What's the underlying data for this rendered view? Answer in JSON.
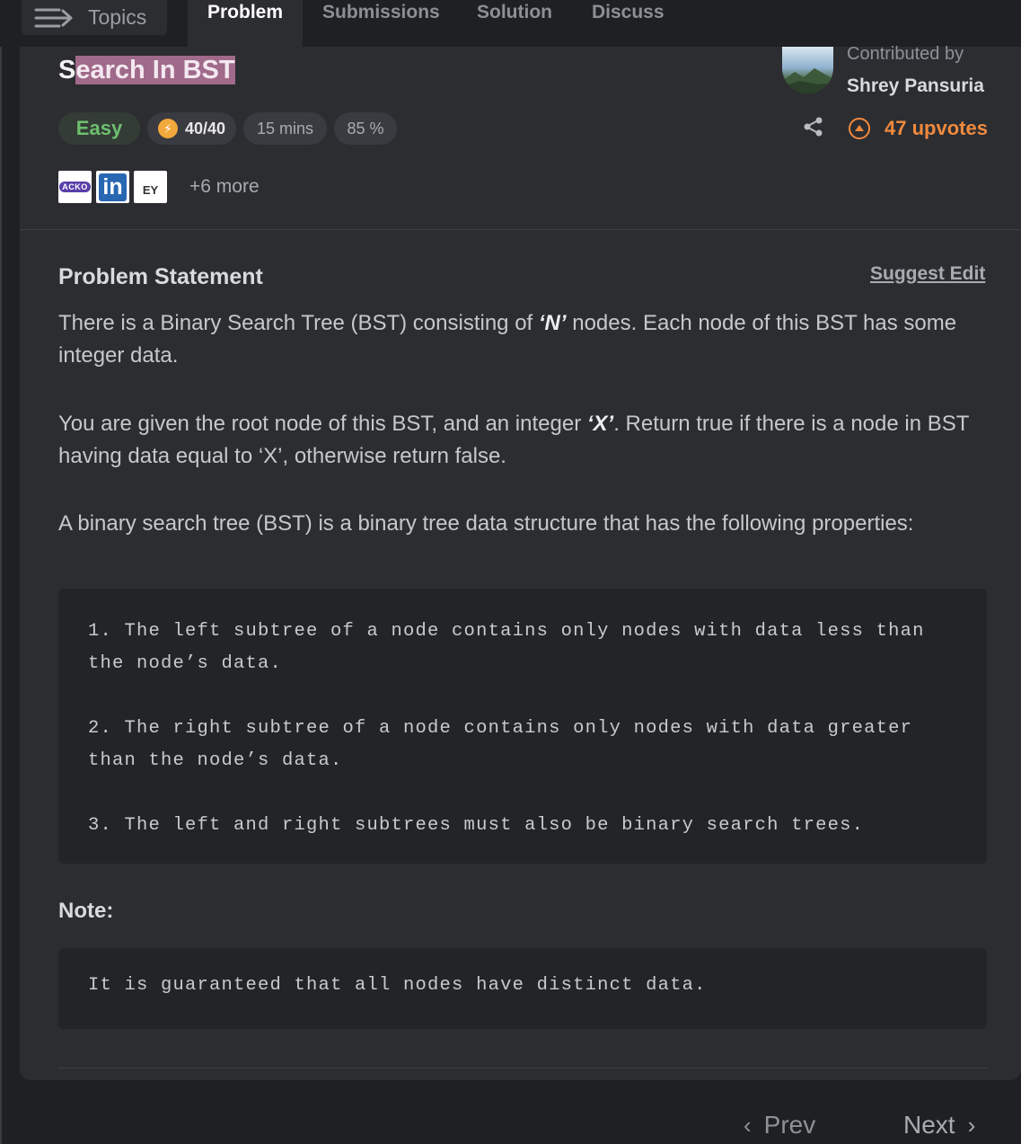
{
  "nav": {
    "topics_label": "Topics",
    "tabs": [
      {
        "label": "Problem",
        "active": true
      },
      {
        "label": "Submissions",
        "active": false
      },
      {
        "label": "Solution",
        "active": false
      },
      {
        "label": "Discuss",
        "active": false
      }
    ]
  },
  "problem": {
    "title_selected": "earch In BST",
    "title_prefix": "S",
    "difficulty": "Easy",
    "score": "40/40",
    "time": "15 mins",
    "success_rate": "85 %",
    "companies": [
      "acko-logo",
      "linkedin-logo",
      "ey-logo"
    ],
    "company_text": {
      "acko": "ACKO",
      "linkedin": "in",
      "ey": "EY"
    },
    "more_companies": "+6 more",
    "contributed_by_label": "Contributed by",
    "contributor": "Shrey Pansuria",
    "upvotes": "47 upvotes"
  },
  "statement": {
    "heading": "Problem Statement",
    "suggest_edit": "Suggest Edit",
    "p1_a": "There is a Binary Search Tree (BST) consisting of ",
    "p1_n": "‘N’",
    "p1_b": " nodes. Each node of this BST has some integer data.",
    "p2_a": "You are given the root node of this BST, and an integer ",
    "p2_x": "‘X’",
    "p2_b": ". Return true if there is a node in BST having data equal to ‘X’, otherwise return false.",
    "p3": "A binary search tree (BST) is a binary tree data structure that has the following properties:",
    "properties": [
      "1. The left subtree of a node contains only nodes with data less than the node’s data.",
      "2. The right subtree of a node contains only nodes with data greater than the node’s data.",
      "3. The left and right subtrees must also be binary search trees."
    ],
    "note_heading": "Note:",
    "note_text": "It is guaranteed that all nodes have distinct data."
  },
  "pager": {
    "prev": "Prev",
    "next": "Next"
  },
  "colors": {
    "accent": "#f08a3e",
    "easy": "#6dbf6f",
    "selection": "#a06a8a"
  }
}
